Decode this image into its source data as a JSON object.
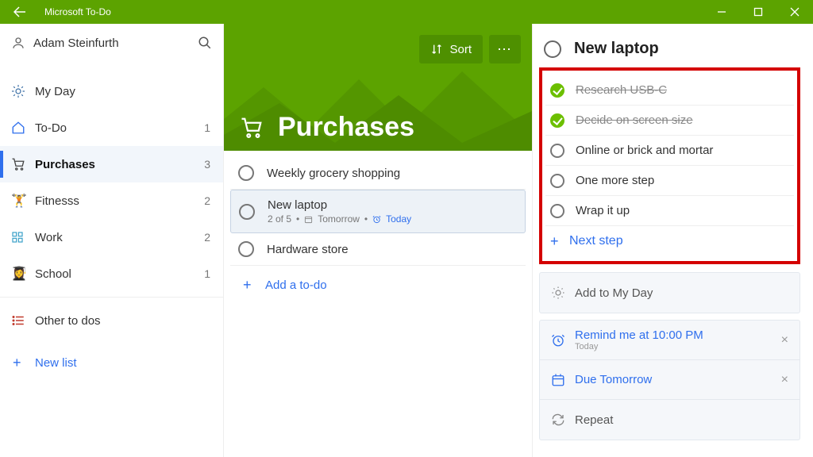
{
  "titlebar": {
    "app_name": "Microsoft To-Do"
  },
  "sidebar": {
    "user_name": "Adam Steinfurth",
    "items": [
      {
        "icon": "sun",
        "label": "My Day",
        "count": ""
      },
      {
        "icon": "home",
        "label": "To-Do",
        "count": "1"
      },
      {
        "icon": "cart",
        "label": "Purchases",
        "count": "3"
      },
      {
        "icon": "fitness",
        "label": "Fitnesss",
        "count": "2"
      },
      {
        "icon": "grid",
        "label": "Work",
        "count": "2"
      },
      {
        "icon": "school",
        "label": "School",
        "count": "1"
      },
      {
        "icon": "list",
        "label": "Other to dos",
        "count": ""
      }
    ],
    "new_list_label": "New list"
  },
  "hero": {
    "title": "Purchases",
    "sort_label": "Sort"
  },
  "tasks": [
    {
      "label": "Weekly grocery shopping",
      "selected": false
    },
    {
      "label": "New laptop",
      "selected": true,
      "meta_count": "2 of 5",
      "meta_due": "Tomorrow",
      "meta_remind": "Today"
    },
    {
      "label": "Hardware store",
      "selected": false
    }
  ],
  "add_todo_label": "Add a to-do",
  "detail": {
    "title": "New laptop",
    "steps": [
      {
        "label": "Research USB-C",
        "done": true
      },
      {
        "label": "Decide on screen size",
        "done": true
      },
      {
        "label": "Online or brick and mortar",
        "done": false
      },
      {
        "label": "One more step",
        "done": false
      },
      {
        "label": "Wrap it up",
        "done": false
      }
    ],
    "next_step_label": "Next step",
    "add_my_day_label": "Add to My Day",
    "remind_main": "Remind me at 10:00 PM",
    "remind_sub": "Today",
    "due_label": "Due Tomorrow",
    "repeat_label": "Repeat"
  }
}
